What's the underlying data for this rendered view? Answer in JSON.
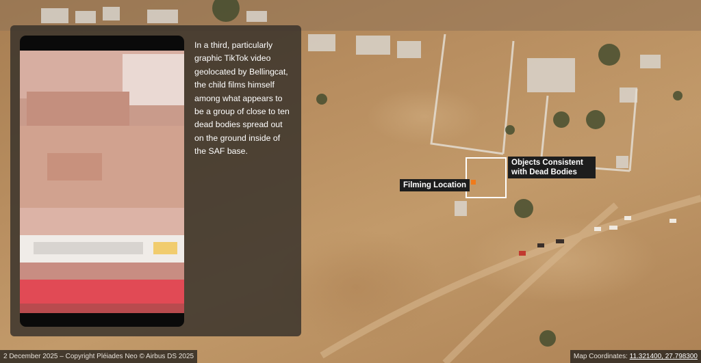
{
  "story": {
    "caption": "In a third, particularly graphic TikTok video geolocated by Bellingcat, the child films himself among what appears to be a group of close to ten dead bodies spread out on the ground inside of the SAF base."
  },
  "map": {
    "labels": {
      "filming_location": "Filming Location",
      "objects_line1": "Objects Consistent",
      "objects_line2": "with Dead Bodies"
    },
    "marker_color": "#f07a1a"
  },
  "footer": {
    "credit": "2 December 2025 – Copyright Pléiades Neo © Airbus DS 2025",
    "coords_label": "Map Coordinates: ",
    "coords_value": "11.321400, 27.798300"
  }
}
